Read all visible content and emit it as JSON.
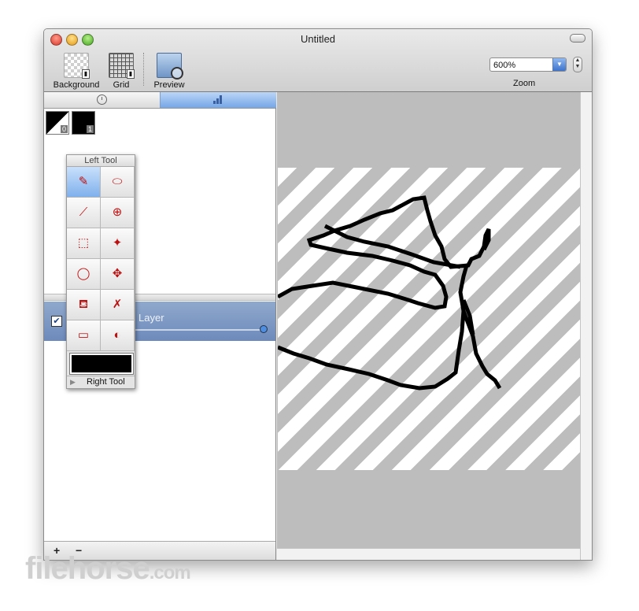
{
  "window": {
    "title": "Untitled"
  },
  "toolbar": {
    "items": [
      {
        "label": "Background",
        "icon": "checkerboard-icon"
      },
      {
        "label": "Grid",
        "icon": "grid-icon"
      },
      {
        "label": "Preview",
        "icon": "preview-icon"
      }
    ],
    "zoom": {
      "value": "600%",
      "label": "Zoom"
    }
  },
  "sidebar": {
    "segments": [
      {
        "icon": "clock-icon",
        "selected": false
      },
      {
        "icon": "bar-chart-icon",
        "selected": true
      }
    ],
    "swatches": [
      {
        "index": "0"
      },
      {
        "index": "1"
      }
    ],
    "layer": {
      "name": "Layer",
      "visible": true
    },
    "bottom_buttons": {
      "add": "+",
      "remove": "−"
    }
  },
  "palette": {
    "title": "Left Tool",
    "tools": [
      {
        "name": "pencil-tool",
        "icon": "pencil-icon",
        "glyph": "✎",
        "selected": true
      },
      {
        "name": "eraser-tool",
        "icon": "eraser-icon",
        "glyph": "⬭",
        "selected": false
      },
      {
        "name": "eyedropper-tool",
        "icon": "eyedropper-icon",
        "glyph": "⟋",
        "selected": false
      },
      {
        "name": "zoom-tool",
        "icon": "magnifier-icon",
        "glyph": "⊕",
        "selected": false
      },
      {
        "name": "marquee-tool",
        "icon": "marquee-icon",
        "glyph": "⬚",
        "selected": false
      },
      {
        "name": "magic-wand-tool",
        "icon": "magic-wand-icon",
        "glyph": "✦",
        "selected": false
      },
      {
        "name": "lasso-tool",
        "icon": "lasso-icon",
        "glyph": "◯",
        "selected": false
      },
      {
        "name": "move-tool",
        "icon": "move-icon",
        "glyph": "✥",
        "selected": false
      },
      {
        "name": "paint-bucket-tool",
        "icon": "paint-bucket-icon",
        "glyph": "⛾",
        "selected": false
      },
      {
        "name": "no-draw-tool",
        "icon": "crossed-pencil-icon",
        "glyph": "✗",
        "selected": false
      },
      {
        "name": "rectangle-tool",
        "icon": "rectangle-pencil-icon",
        "glyph": "▭",
        "selected": false
      },
      {
        "name": "ellipse-tool",
        "icon": "ellipse-pencil-icon",
        "glyph": "◐",
        "selected": false
      }
    ],
    "color": "#000000",
    "footer": "Right Tool"
  },
  "colors": {
    "accent": "#74a6e6",
    "stripe": "#bdbdbd",
    "canvas_bg": "#bdbdbd",
    "ink": "#000000"
  },
  "watermark": {
    "text": "filehorse",
    "suffix": ".com"
  }
}
